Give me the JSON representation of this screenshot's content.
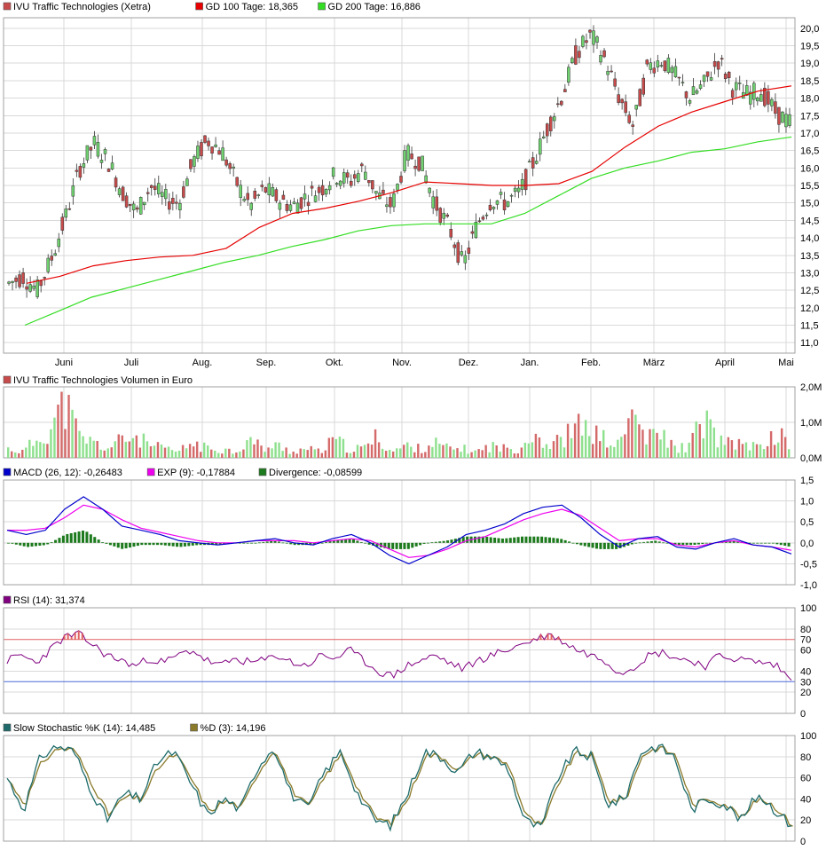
{
  "colors": {
    "price_up": "#6fd26f",
    "price_down": "#c84b4b",
    "gd100": "#e60000",
    "gd200": "#33dd22",
    "vol_up": "#8ee08e",
    "vol_down": "#d46a6a",
    "macd": "#0000cc",
    "exp": "#ee00ee",
    "divergence": "#1d7a1d",
    "rsi": "#800080",
    "rsi_upper": "#e06060",
    "rsi_lower": "#4a6adc",
    "stoch_k": "#1f6b6b",
    "stoch_d": "#8a7a2a"
  },
  "price_panel": {
    "legend": [
      {
        "label": "IVU Traffic Technologies (Xetra)",
        "swatch": "#c84b4b"
      },
      {
        "label": "GD 100 Tage: 18,365",
        "swatch": "#e60000"
      },
      {
        "label": "GD 200 Tage: 16,886",
        "swatch": "#33dd22"
      }
    ],
    "yticks": [
      "20,0",
      "19,5",
      "19,0",
      "18,5",
      "18,0",
      "17,5",
      "17,0",
      "16,5",
      "16,0",
      "15,5",
      "15,0",
      "14,5",
      "14,0",
      "13,5",
      "13,0",
      "12,5",
      "12,0",
      "11,5",
      "11,0"
    ],
    "xticks": [
      "Juni",
      "Juli",
      "Aug.",
      "Sep.",
      "Okt.",
      "Nov.",
      "Dez.",
      "Jan.",
      "Feb.",
      "März",
      "April",
      "Mai"
    ]
  },
  "volume_panel": {
    "legend": [
      {
        "label": "IVU Traffic Technologies Volumen in Euro",
        "swatch": "#c84b4b"
      }
    ],
    "yticks": [
      "2,0M",
      "1,0M",
      "0,0M"
    ]
  },
  "macd_panel": {
    "legend": [
      {
        "label": "MACD (26, 12): -0,26483",
        "swatch": "#0000cc"
      },
      {
        "label": "EXP (9): -0,17884",
        "swatch": "#ee00ee"
      },
      {
        "label": "Divergence: -0,08599",
        "swatch": "#1d7a1d"
      }
    ],
    "yticks": [
      "1,5",
      "1,0",
      "0,5",
      "0,0",
      "-0,5",
      "-1,0"
    ]
  },
  "rsi_panel": {
    "legend": [
      {
        "label": "RSI (14): 31,374",
        "swatch": "#800080"
      }
    ],
    "yticks": [
      "100",
      "80",
      "70",
      "60",
      "40",
      "30",
      "20",
      "0"
    ]
  },
  "stoch_panel": {
    "legend": [
      {
        "label": "Slow Stochastic %K (14): 14,485",
        "swatch": "#1f6b6b"
      },
      {
        "label": "%D (3): 14,196",
        "swatch": "#8a7a2a"
      }
    ],
    "yticks": [
      "100",
      "80",
      "60",
      "40",
      "20",
      "0"
    ]
  },
  "chart_data": [
    {
      "type": "line",
      "title": "IVU Traffic Technologies (Xetra)",
      "ylim": [
        10.7,
        20.3
      ],
      "x_labels": [
        "Juni",
        "Juli",
        "Aug.",
        "Sep.",
        "Okt.",
        "Nov.",
        "Dez.",
        "Jan.",
        "Feb.",
        "März",
        "April",
        "Mai"
      ],
      "series": [
        {
          "name": "IVU Traffic Technologies (Xetra)",
          "values": [
            12.7,
            12.9,
            12.5,
            13.4,
            14.6,
            16.0,
            16.7,
            16.2,
            15.3,
            14.7,
            15.5,
            15.1,
            15.0,
            16.2,
            16.8,
            16.5,
            15.6,
            14.9,
            15.4,
            15.1,
            14.9,
            15.2,
            15.4,
            15.8,
            15.6,
            16.0,
            15.2,
            14.9,
            16.4,
            16.2,
            15.0,
            14.3,
            13.2,
            14.4,
            15.1,
            15.0,
            15.3,
            16.2,
            17.2,
            18.1,
            19.3,
            19.8,
            19.1,
            18.0,
            17.2,
            18.9,
            19.1,
            18.6,
            18.0,
            18.4,
            19.1,
            18.3,
            18.1,
            18.2,
            17.6,
            17.3
          ],
          "format": "close"
        },
        {
          "name": "GD 100 Tage",
          "values": [
            12.7,
            12.9,
            13.2,
            13.35,
            13.45,
            13.5,
            13.7,
            14.3,
            14.7,
            14.85,
            15.05,
            15.3,
            15.6,
            15.55,
            15.5,
            15.5,
            15.55,
            15.9,
            16.6,
            17.2,
            17.6,
            17.9,
            18.2,
            18.35
          ],
          "format": "moving-average"
        },
        {
          "name": "GD 200 Tage",
          "values": [
            11.5,
            11.9,
            12.3,
            12.55,
            12.8,
            13.05,
            13.3,
            13.5,
            13.75,
            13.95,
            14.2,
            14.35,
            14.4,
            14.4,
            14.4,
            14.7,
            15.2,
            15.7,
            16.0,
            16.2,
            16.45,
            16.55,
            16.75,
            16.886
          ],
          "format": "moving-average"
        }
      ]
    },
    {
      "type": "bar",
      "title": "IVU Traffic Technologies Volumen in Euro",
      "ylim": [
        0,
        2.0
      ],
      "units": "M",
      "series": [
        {
          "name": "IVU Traffic Technologies Volumen in Euro",
          "values": [
            0.3,
            0.2,
            0.6,
            1.0,
            1.8,
            0.7,
            0.5,
            0.3,
            0.6,
            0.7,
            0.4,
            0.3,
            0.2,
            0.5,
            0.3,
            0.3,
            0.2,
            0.6,
            0.3,
            0.4,
            0.2,
            0.3,
            0.2,
            0.6,
            0.3,
            0.3,
            0.7,
            0.2,
            0.4,
            0.3,
            0.5,
            0.3,
            0.3,
            0.2,
            0.4,
            0.3,
            0.3,
            0.9,
            0.4,
            0.6,
            1.0,
            0.9,
            0.6,
            0.4,
            1.5,
            0.6,
            0.8,
            0.3,
            0.4,
            1.3,
            0.6,
            0.4,
            0.5,
            0.3,
            0.8,
            0.5
          ]
        }
      ]
    },
    {
      "type": "line",
      "title": "MACD",
      "ylim": [
        -1.0,
        1.5
      ],
      "series": [
        {
          "name": "MACD (26, 12)",
          "values": [
            0.3,
            0.2,
            0.3,
            0.8,
            1.1,
            0.8,
            0.4,
            0.3,
            0.2,
            0.05,
            0.0,
            -0.05,
            0.0,
            0.05,
            0.1,
            0.0,
            -0.05,
            0.1,
            0.2,
            0.0,
            -0.3,
            -0.5,
            -0.3,
            -0.1,
            0.2,
            0.3,
            0.45,
            0.7,
            0.85,
            0.9,
            0.6,
            0.2,
            -0.1,
            0.1,
            0.15,
            -0.1,
            -0.15,
            0.0,
            0.1,
            -0.05,
            -0.1,
            -0.26483
          ]
        },
        {
          "name": "EXP (9)",
          "values": [
            0.3,
            0.3,
            0.35,
            0.6,
            0.9,
            0.8,
            0.55,
            0.35,
            0.25,
            0.15,
            0.05,
            0.0,
            0.0,
            0.05,
            0.05,
            0.05,
            0.0,
            0.05,
            0.1,
            0.05,
            -0.15,
            -0.35,
            -0.3,
            -0.15,
            0.05,
            0.15,
            0.35,
            0.55,
            0.7,
            0.8,
            0.65,
            0.35,
            0.05,
            0.1,
            0.1,
            -0.05,
            -0.1,
            0.0,
            0.05,
            -0.05,
            -0.1,
            -0.17884
          ]
        },
        {
          "name": "Divergence",
          "values": [
            0.0,
            -0.1,
            -0.05,
            0.2,
            0.3,
            0.0,
            -0.15,
            -0.05,
            -0.05,
            -0.1,
            -0.05,
            -0.05,
            0.0,
            0.0,
            0.05,
            -0.05,
            -0.05,
            0.05,
            0.1,
            -0.05,
            -0.15,
            -0.15,
            0.0,
            0.05,
            0.15,
            0.15,
            0.1,
            0.15,
            0.15,
            0.1,
            -0.05,
            -0.15,
            -0.15,
            0.0,
            0.05,
            -0.05,
            -0.05,
            0.0,
            0.05,
            0.0,
            0.0,
            -0.08599
          ]
        }
      ]
    },
    {
      "type": "line",
      "title": "RSI (14)",
      "ylim": [
        0,
        100
      ],
      "reference_lines": [
        70,
        30
      ],
      "series": [
        {
          "name": "RSI (14)",
          "values": [
            50,
            55,
            48,
            60,
            72,
            75,
            65,
            55,
            50,
            45,
            52,
            48,
            55,
            60,
            50,
            45,
            52,
            48,
            50,
            55,
            48,
            45,
            55,
            52,
            60,
            50,
            40,
            35,
            45,
            50,
            55,
            48,
            42,
            50,
            55,
            60,
            65,
            70,
            75,
            68,
            60,
            55,
            50,
            38,
            45,
            55,
            58,
            52,
            50,
            45,
            55,
            52,
            50,
            48,
            45,
            31.374
          ]
        }
      ]
    },
    {
      "type": "line",
      "title": "Slow Stochastic",
      "ylim": [
        0,
        100
      ],
      "series": [
        {
          "name": "Slow Stochastic %K (14)",
          "values": [
            60,
            30,
            80,
            90,
            85,
            50,
            20,
            45,
            40,
            75,
            85,
            55,
            25,
            40,
            30,
            70,
            90,
            45,
            30,
            65,
            85,
            45,
            20,
            15,
            45,
            85,
            80,
            65,
            85,
            80,
            70,
            20,
            12,
            60,
            85,
            80,
            35,
            40,
            85,
            90,
            80,
            30,
            40,
            35,
            20,
            45,
            30,
            14.485
          ]
        },
        {
          "name": "%D (3)",
          "values": [
            58,
            35,
            75,
            88,
            86,
            55,
            25,
            42,
            40,
            70,
            83,
            58,
            28,
            38,
            32,
            66,
            88,
            48,
            32,
            62,
            83,
            48,
            22,
            17,
            42,
            82,
            80,
            67,
            83,
            80,
            72,
            24,
            14,
            56,
            83,
            81,
            38,
            40,
            82,
            89,
            81,
            34,
            40,
            35,
            22,
            42,
            32,
            14.196
          ]
        }
      ]
    }
  ]
}
